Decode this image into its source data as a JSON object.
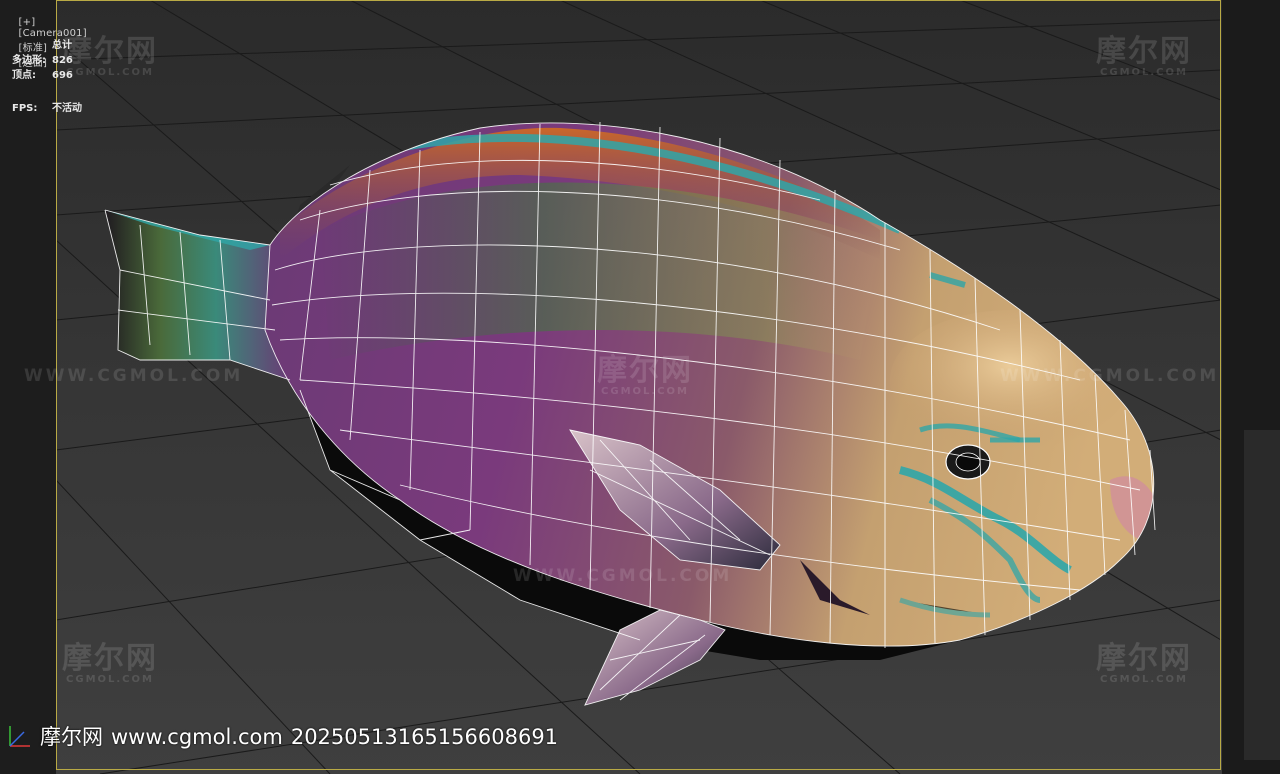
{
  "viewport": {
    "labels": [
      "[+]",
      "[Camera001]",
      "[标准]",
      "[边面]"
    ],
    "stats": {
      "header": "总计",
      "rows": [
        {
          "key": "多边形:",
          "value": "826"
        },
        {
          "key": "顶点:",
          "value": "696"
        }
      ]
    },
    "fps": {
      "key": "FPS:",
      "value": "不活动"
    }
  },
  "watermarks": {
    "brand": "摩尔网",
    "brand_sub": "CGMOL.COM",
    "url_text": "WWW.CGMOL.COM"
  },
  "footer": {
    "brand": "摩尔网",
    "url": "www.cgmol.com",
    "id": "20250513165156608691"
  },
  "colors": {
    "frame": "#b9aa45",
    "fish_body": "#7d3a7e",
    "fish_head": "#c9a86a",
    "fish_dorsal": "#c96a2a",
    "fish_accent": "#2fa6a8",
    "wire": "#ffffff"
  }
}
